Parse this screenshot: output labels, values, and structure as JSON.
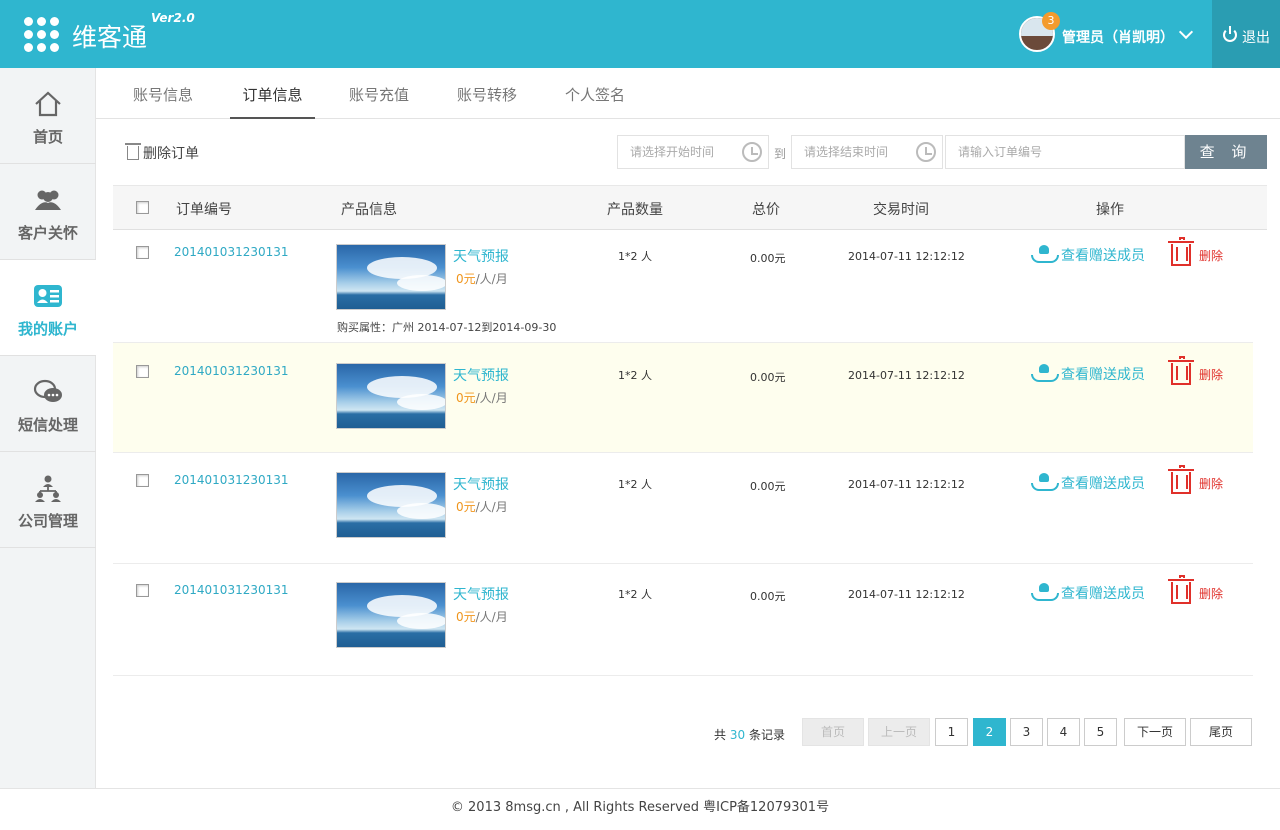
{
  "header": {
    "brand": "维客通",
    "version": "Ver2.0",
    "notification_count": "3",
    "user": "管理员（肖凯明）",
    "logout": "退出"
  },
  "sidebar": {
    "items": [
      {
        "label": "首页",
        "icon": "home-icon"
      },
      {
        "label": "客户关怀",
        "icon": "customers-icon"
      },
      {
        "label": "我的账户",
        "icon": "account-icon",
        "active": true
      },
      {
        "label": "短信处理",
        "icon": "sms-icon"
      },
      {
        "label": "公司管理",
        "icon": "org-icon"
      }
    ]
  },
  "tabs": [
    "账号信息",
    "订单信息",
    "账号充值",
    "账号转移",
    "个人签名"
  ],
  "toolbar": {
    "delete_orders": "删除订单",
    "start_placeholder": "请选择开始时间",
    "to": "到",
    "end_placeholder": "请选择结束时间",
    "order_placeholder": "请输入订单编号",
    "search": "查 询"
  },
  "table": {
    "headers": [
      "订单编号",
      "产品信息",
      "产品数量",
      "总价",
      "交易时间",
      "操作"
    ],
    "rows": [
      {
        "order_id": "201401031230131",
        "product": "天气预报",
        "price": "0元",
        "unit": "/人/月",
        "attr": "购买属性：广州 2014-07-12到2014-09-30",
        "qty": "1*2 人",
        "total": "0.00元",
        "time": "2014-07-11 12:12:12",
        "gift": "查看赠送成员",
        "delete": "删除"
      },
      {
        "order_id": "201401031230131",
        "product": "天气预报",
        "price": "0元",
        "unit": "/人/月",
        "qty": "1*2 人",
        "total": "0.00元",
        "time": "2014-07-11 12:12:12",
        "gift": "查看赠送成员",
        "delete": "删除"
      },
      {
        "order_id": "201401031230131",
        "product": "天气预报",
        "price": "0元",
        "unit": "/人/月",
        "qty": "1*2 人",
        "total": "0.00元",
        "time": "2014-07-11 12:12:12",
        "gift": "查看赠送成员",
        "delete": "删除"
      },
      {
        "order_id": "201401031230131",
        "product": "天气预报",
        "price": "0元",
        "unit": "/人/月",
        "qty": "1*2 人",
        "total": "0.00元",
        "time": "2014-07-11 12:12:12",
        "gift": "查看赠送成员",
        "delete": "删除"
      }
    ]
  },
  "pagination": {
    "prefix": "共",
    "total": "30",
    "suffix": "条记录",
    "first": "首页",
    "prev": "上一页",
    "pages": [
      "1",
      "2",
      "3",
      "4",
      "5"
    ],
    "current": "2",
    "next": "下一页",
    "last": "尾页"
  },
  "footer": "© 2013 8msg.cn , All Rights Reserved 粤ICP备12079301号",
  "colors": {
    "accent": "#2fb6cf",
    "price": "#f0951c",
    "danger": "#e0302a"
  }
}
